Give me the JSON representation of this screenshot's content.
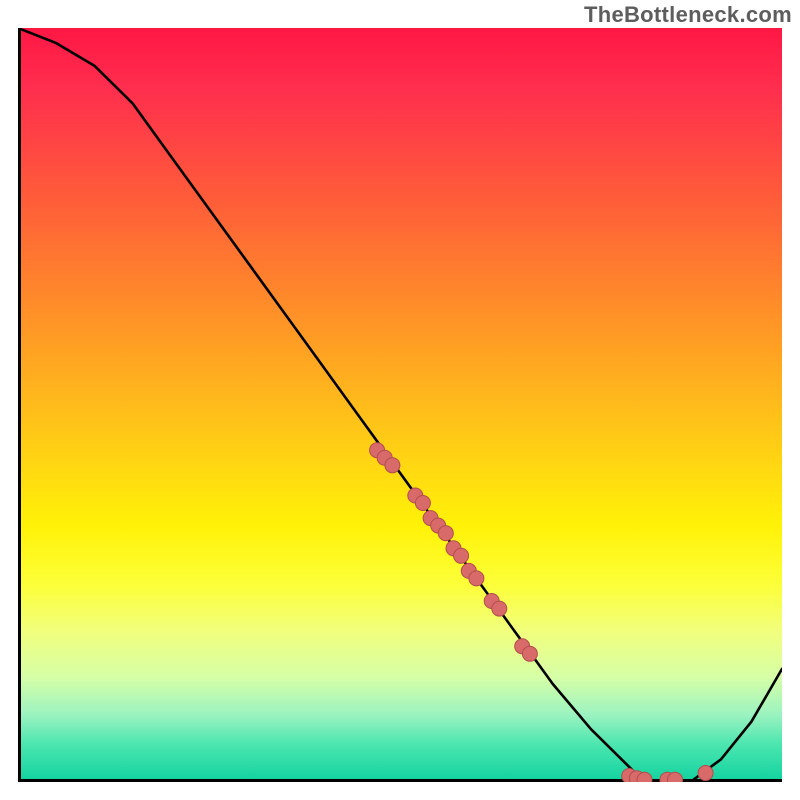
{
  "watermark": "TheBottleneck.com",
  "colors": {
    "gradient_top": "#ff1744",
    "gradient_bottom": "#10d29f",
    "marker": "#d86a6a",
    "curve": "#000000",
    "axes": "#000000"
  },
  "chart_data": {
    "type": "line",
    "title": "",
    "xlabel": "",
    "ylabel": "",
    "xlim": [
      0,
      100
    ],
    "ylim": [
      0,
      100
    ],
    "grid": false,
    "legend": false,
    "series": [
      {
        "name": "curve",
        "x": [
          0,
          5,
          10,
          15,
          20,
          25,
          30,
          35,
          40,
          45,
          50,
          55,
          60,
          65,
          70,
          75,
          80,
          82,
          85,
          88,
          92,
          96,
          100
        ],
        "y": [
          100,
          98,
          95,
          90,
          83,
          76,
          69,
          62,
          55,
          48,
          41,
          34,
          27,
          20,
          13,
          7,
          2,
          0,
          0,
          0,
          3,
          8,
          15
        ]
      }
    ],
    "markers": [
      {
        "x": 47,
        "y": 44
      },
      {
        "x": 48,
        "y": 43
      },
      {
        "x": 49,
        "y": 42
      },
      {
        "x": 52,
        "y": 38
      },
      {
        "x": 53,
        "y": 37
      },
      {
        "x": 54,
        "y": 35
      },
      {
        "x": 55,
        "y": 34
      },
      {
        "x": 56,
        "y": 33
      },
      {
        "x": 57,
        "y": 31
      },
      {
        "x": 58,
        "y": 30
      },
      {
        "x": 59,
        "y": 28
      },
      {
        "x": 60,
        "y": 27
      },
      {
        "x": 62,
        "y": 24
      },
      {
        "x": 63,
        "y": 23
      },
      {
        "x": 66,
        "y": 18
      },
      {
        "x": 67,
        "y": 17
      },
      {
        "x": 80,
        "y": 0.8
      },
      {
        "x": 81,
        "y": 0.5
      },
      {
        "x": 82,
        "y": 0.3
      },
      {
        "x": 85,
        "y": 0.3
      },
      {
        "x": 86,
        "y": 0.3
      },
      {
        "x": 90,
        "y": 1.2
      }
    ]
  }
}
